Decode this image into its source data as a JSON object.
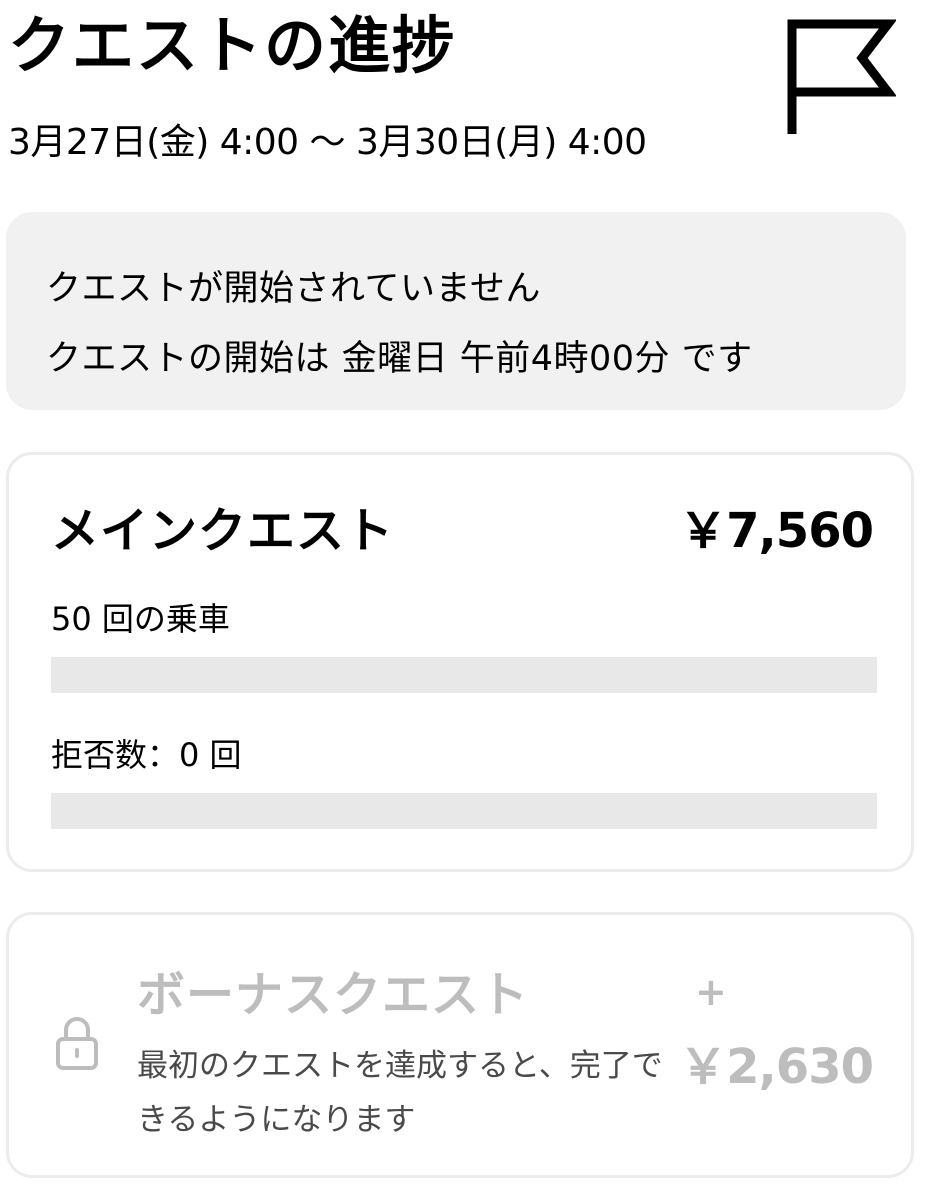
{
  "header": {
    "title": "クエストの進捗",
    "date_range": "3月27日(金) 4:00 〜 3月30日(月) 4:00",
    "icon": "flag-icon"
  },
  "notice": {
    "line1": "クエストが開始されていません",
    "line2": "クエストの開始は 金曜日 午前4時00分 です"
  },
  "main_quest": {
    "title": "メインクエスト",
    "amount": "￥7,560",
    "goal_label": "50 回の乗車",
    "reject_label": "拒否数：0 回",
    "goal_progress": 0,
    "reject_progress": 0
  },
  "bonus_quest": {
    "title": "ボーナスクエスト",
    "plus": "+",
    "amount": "￥2,630",
    "description": "最初のクエストを達成すると、完了できるようになります",
    "icon": "lock-icon",
    "locked": true
  },
  "colors": {
    "text": "#000000",
    "notice_bg": "#f1f1f1",
    "bar_track": "#e8e8e8",
    "disabled_text": "#bdbdbd"
  }
}
